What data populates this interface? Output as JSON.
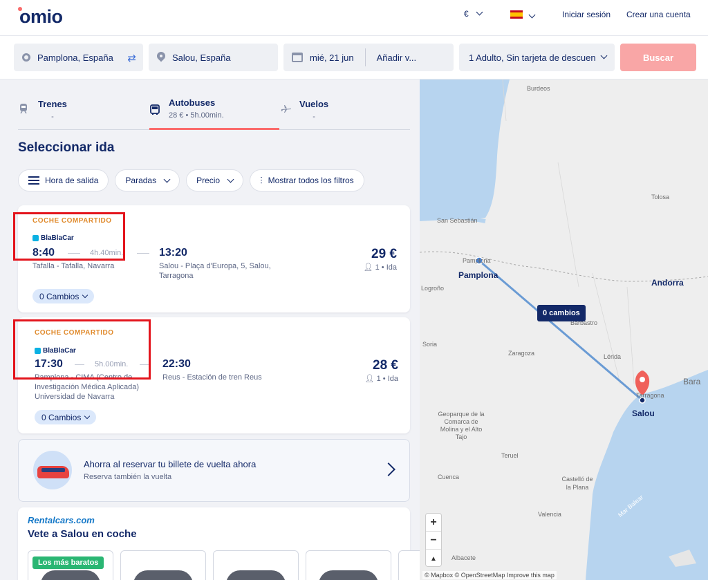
{
  "header": {
    "logo": "omio",
    "currency": "€",
    "login": "Iniciar sesión",
    "signup": "Crear una cuenta"
  },
  "search": {
    "origin": "Pamplona, España",
    "destination": "Salou, España",
    "date": "mié, 21 jun",
    "return": "Añadir v...",
    "passengers": "1 Adulto, Sin tarjeta de descuen",
    "button": "Buscar"
  },
  "tabs": [
    {
      "label": "Trenes",
      "sub": "-"
    },
    {
      "label": "Autobuses",
      "sub": "28 € • 5h.00min."
    },
    {
      "label": "Vuelos",
      "sub": "-"
    }
  ],
  "page_title": "Seleccionar ida",
  "filters": [
    "Hora de salida",
    "Paradas",
    "Precio",
    "Mostrar todos los filtros"
  ],
  "results": [
    {
      "type": "COCHE COMPARTIDO",
      "brand": "BlaBlaCar",
      "depart": "8:40",
      "duration": "4h.40min.",
      "arrive": "13:20",
      "from": "Tafalla - Tafalla, Navarra",
      "to": "Salou - Plaça d'Europa, 5, Salou, Tarragona",
      "price": "29 €",
      "pax": "1 • Ida",
      "changes": "0 Cambios"
    },
    {
      "type": "COCHE COMPARTIDO",
      "brand": "BlaBlaCar",
      "depart": "17:30",
      "duration": "5h.00min.",
      "arrive": "22:30",
      "from": "Pamplona - CIMA (Centro de Investigación Médica Aplicada) Universidad de Navarra",
      "to": "Reus - Estación de tren Reus",
      "price": "28 €",
      "pax": "1 • Ida",
      "changes": "0 Cambios"
    }
  ],
  "promo": {
    "title": "Ahorra al reservar tu billete de vuelta ahora",
    "subtitle": "Reserva también la vuelta"
  },
  "rental": {
    "logo": "Rentalcars.com",
    "title": "Vete a Salou en coche",
    "cheapest_badge": "Los más baratos"
  },
  "map": {
    "tooltip": "0 cambios",
    "origin_city": "Pamplona",
    "destination_city": "Salou",
    "labels": [
      "Burdeos",
      "Tolosa",
      "San Sebastián",
      "Pamplona",
      "Logroño",
      "Andorra",
      "Barbastro",
      "Soria",
      "Zaragoza",
      "Lérida",
      "Tarragona",
      "Bara",
      "Geoparque de la Comarca de Molina y el Alto Tajo",
      "Teruel",
      "Cuenca",
      "Castelló de la Plana",
      "Mar Balear",
      "Valencia",
      "Albacete"
    ],
    "attribution": "© Mapbox © OpenStreetMap  Improve this map",
    "colors": {
      "water": "#b7d4ef",
      "route": "#6a9bd4",
      "pin": "#f0605a"
    }
  }
}
